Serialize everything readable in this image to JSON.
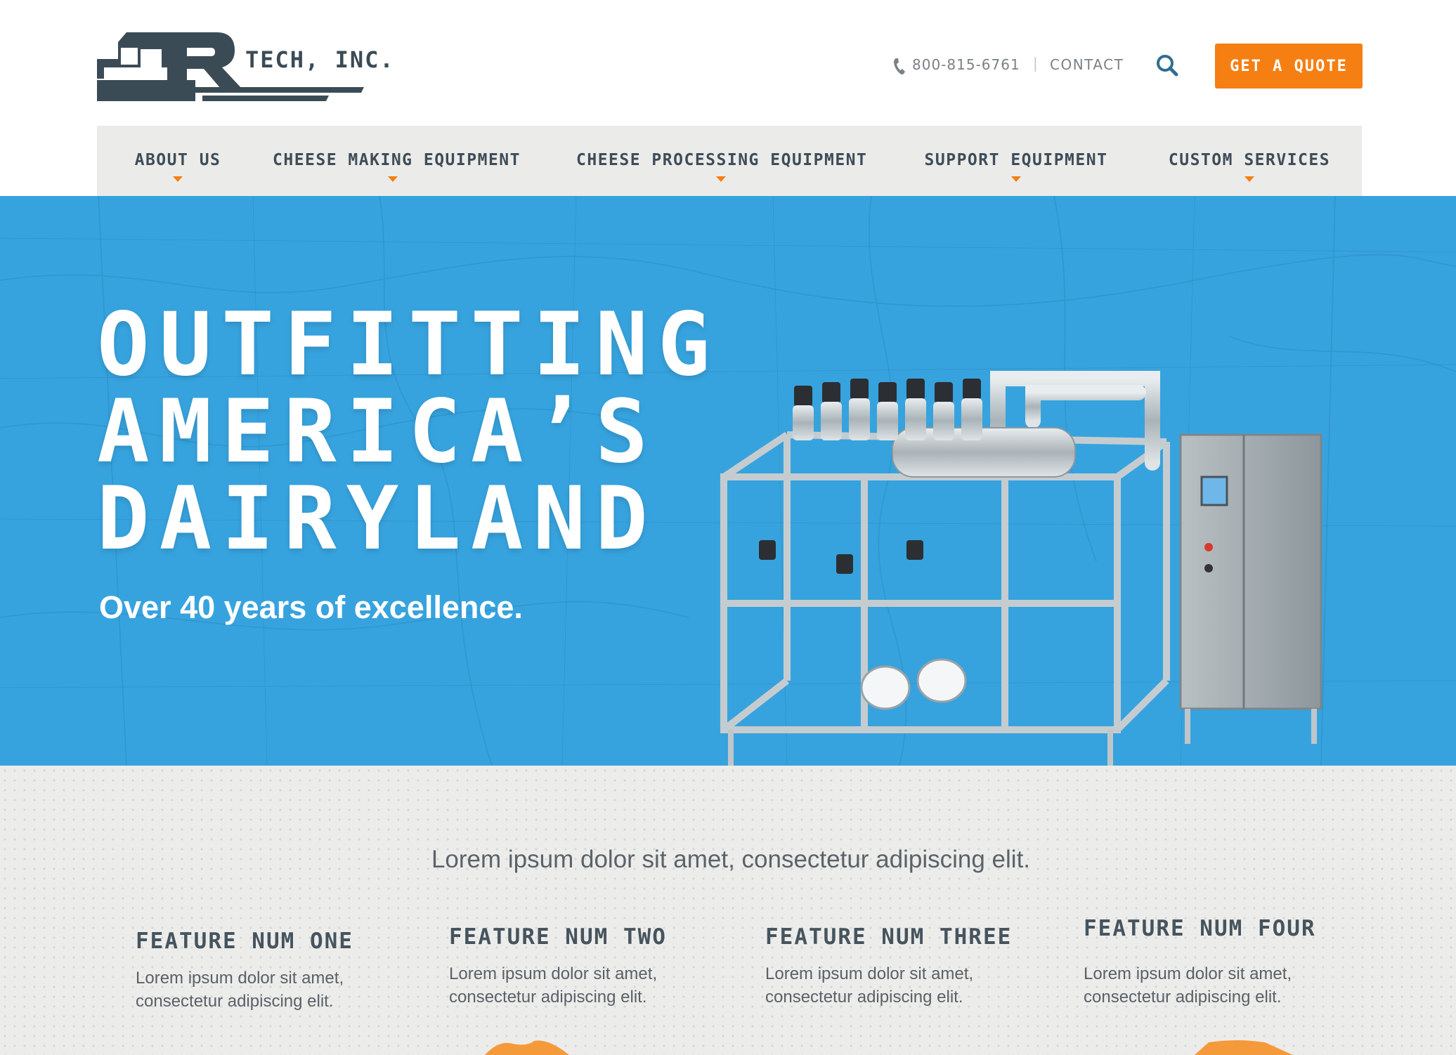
{
  "brand": {
    "name": "TECH, INC.",
    "logo_letters": "DR",
    "accent_color": "#f57f12",
    "primary_color": "#3b4b56",
    "hero_color": "#37a3de"
  },
  "header": {
    "phone": "800-815-6761",
    "separator": "|",
    "contact_label": "CONTACT",
    "quote_label": "GET A QUOTE",
    "phone_icon": "phone-icon",
    "search_icon": "search-icon"
  },
  "nav": {
    "items": [
      {
        "label": "ABOUT US",
        "icon": "caret-down-icon"
      },
      {
        "label": "CHEESE MAKING EQUIPMENT",
        "icon": "caret-down-icon"
      },
      {
        "label": "CHEESE PROCESSING EQUIPMENT",
        "icon": "caret-down-icon"
      },
      {
        "label": "SUPPORT EQUIPMENT",
        "icon": "caret-down-icon"
      },
      {
        "label": "CUSTOM SERVICES",
        "icon": "caret-down-icon"
      }
    ]
  },
  "hero": {
    "headline_lines": [
      "OUTFITTING",
      "AMERICA’S",
      "DAIRYLAND"
    ],
    "subheadline": "Over 40 years of excellence."
  },
  "features": {
    "intro": "Lorem ipsum dolor sit amet, consectetur adipiscing elit.",
    "items": [
      {
        "title": "FEATURE NUM ONE",
        "body": "Lorem ipsum dolor sit amet, consectetur adipiscing elit."
      },
      {
        "title": "FEATURE NUM TWO",
        "body": "Lorem ipsum dolor sit amet, consectetur adipiscing elit."
      },
      {
        "title": "FEATURE NUM THREE",
        "body": "Lorem ipsum dolor sit amet, consectetur adipiscing elit."
      },
      {
        "title": "FEATURE NUM FOUR",
        "body": "Lorem ipsum dolor sit amet, consectetur adipiscing elit."
      }
    ]
  }
}
